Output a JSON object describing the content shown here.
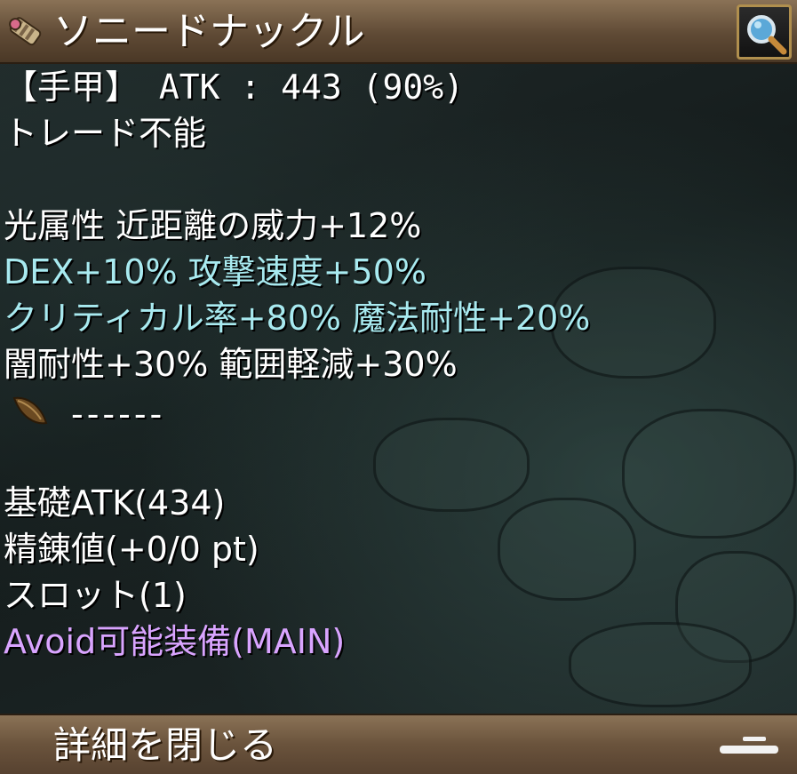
{
  "header": {
    "title": "ソニードナックル",
    "item_icon": "knuckle-icon",
    "search_icon": "magnifier-icon"
  },
  "details": {
    "type_line": "【手甲】 ATK : 443 (90%)",
    "trade_line": "トレード不能",
    "stat_lines": [
      {
        "text": "光属性 近距離の威力+12%",
        "color": "#ffffff"
      },
      {
        "text": "DEX+10% 攻撃速度+50%",
        "color": "#a8eaf0"
      },
      {
        "text": "クリティカル率+80% 魔法耐性+20%",
        "color": "#a8eaf0"
      },
      {
        "text": "闇耐性+30% 範囲軽減+30%",
        "color": "#ffffff"
      }
    ],
    "crystal_slot": "------",
    "crystal_icon": "seed-icon",
    "base_atk": "基礎ATK(434)",
    "refine": "精錬値(+0/0 pt)",
    "slot": "スロット(1)",
    "avoid": "Avoid可能装備(MAIN)"
  },
  "footer": {
    "close_label": "詳細を閉じる"
  },
  "colors": {
    "header_bg": "#6e5840",
    "stat_cyan": "#a8eaf0",
    "avoid_purple": "#d9a4ff"
  }
}
